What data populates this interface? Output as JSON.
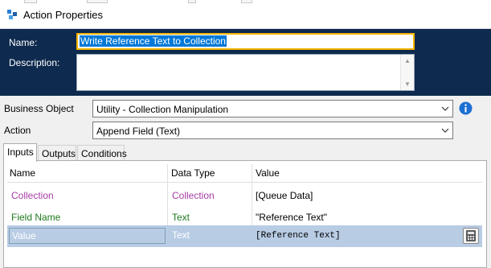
{
  "window": {
    "title": "Action Properties",
    "icon": "process-icon"
  },
  "header": {
    "name_label": "Name:",
    "name_value": "Write Reference Text to Collection",
    "description_label": "Description:",
    "description_value": ""
  },
  "form": {
    "business_object_label": "Business Object",
    "business_object_value": "Utility - Collection Manipulation",
    "action_label": "Action",
    "action_value": "Append Field (Text)",
    "info_icon": "info-icon"
  },
  "tabs": [
    {
      "label": "Inputs",
      "active": true
    },
    {
      "label": "Outputs",
      "active": false
    },
    {
      "label": "Conditions",
      "active": false
    }
  ],
  "grid": {
    "columns": [
      "Name",
      "Data Type",
      "Value"
    ],
    "rows": [
      {
        "name": "Collection",
        "type": "Collection",
        "value": "[Queue Data]",
        "color": "#a53ca5"
      },
      {
        "name": "Field Name",
        "type": "Text",
        "value": "\"Reference Text\"",
        "color": "#1e7a1e"
      },
      {
        "name": "Value",
        "type": "Text",
        "value": "[Reference Text]",
        "color": "#ffffff",
        "selected": true
      }
    ],
    "expression_button_icon": "calculator-icon"
  },
  "colors": {
    "header_bg": "#0e2a4e",
    "focus_border": "#f5b400",
    "selection": "#0078d7",
    "selected_row": "#b8cce4"
  }
}
